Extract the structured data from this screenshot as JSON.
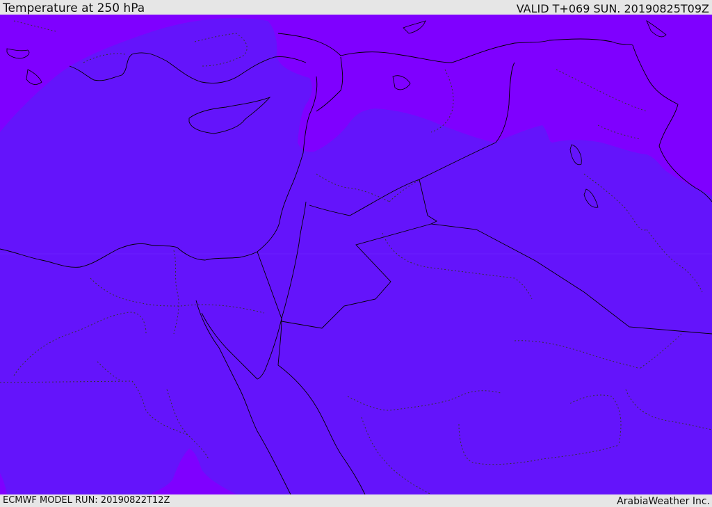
{
  "header": {
    "title": "Temperature at 250 hPa",
    "valid": "VALID T+069 SUN. 20190825T09Z"
  },
  "footer": {
    "model_run": "ECMWF MODEL RUN: 20190822T12Z",
    "credit": "ArabiaWeather Inc."
  },
  "map": {
    "field": "temperature-250hPa",
    "colors": {
      "cold_band": "#7f00ff",
      "warm_band": "#6414fb",
      "coastline": "#000000",
      "border_dotted": "#333333"
    }
  }
}
